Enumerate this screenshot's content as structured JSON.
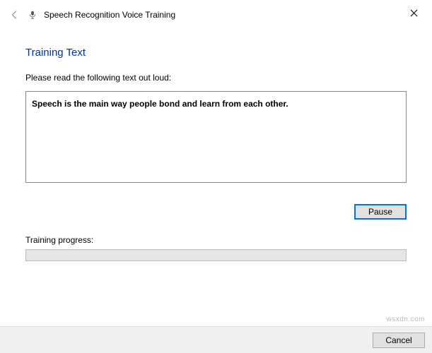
{
  "window": {
    "title": "Speech Recognition Voice Training"
  },
  "section": {
    "heading": "Training Text",
    "instruction": "Please read the following text out loud:",
    "sentence": "Speech is the main way people bond and learn from each other."
  },
  "buttons": {
    "pause": "Pause",
    "cancel": "Cancel"
  },
  "progress": {
    "label": "Training progress:"
  },
  "watermark": "wsxdn.com"
}
